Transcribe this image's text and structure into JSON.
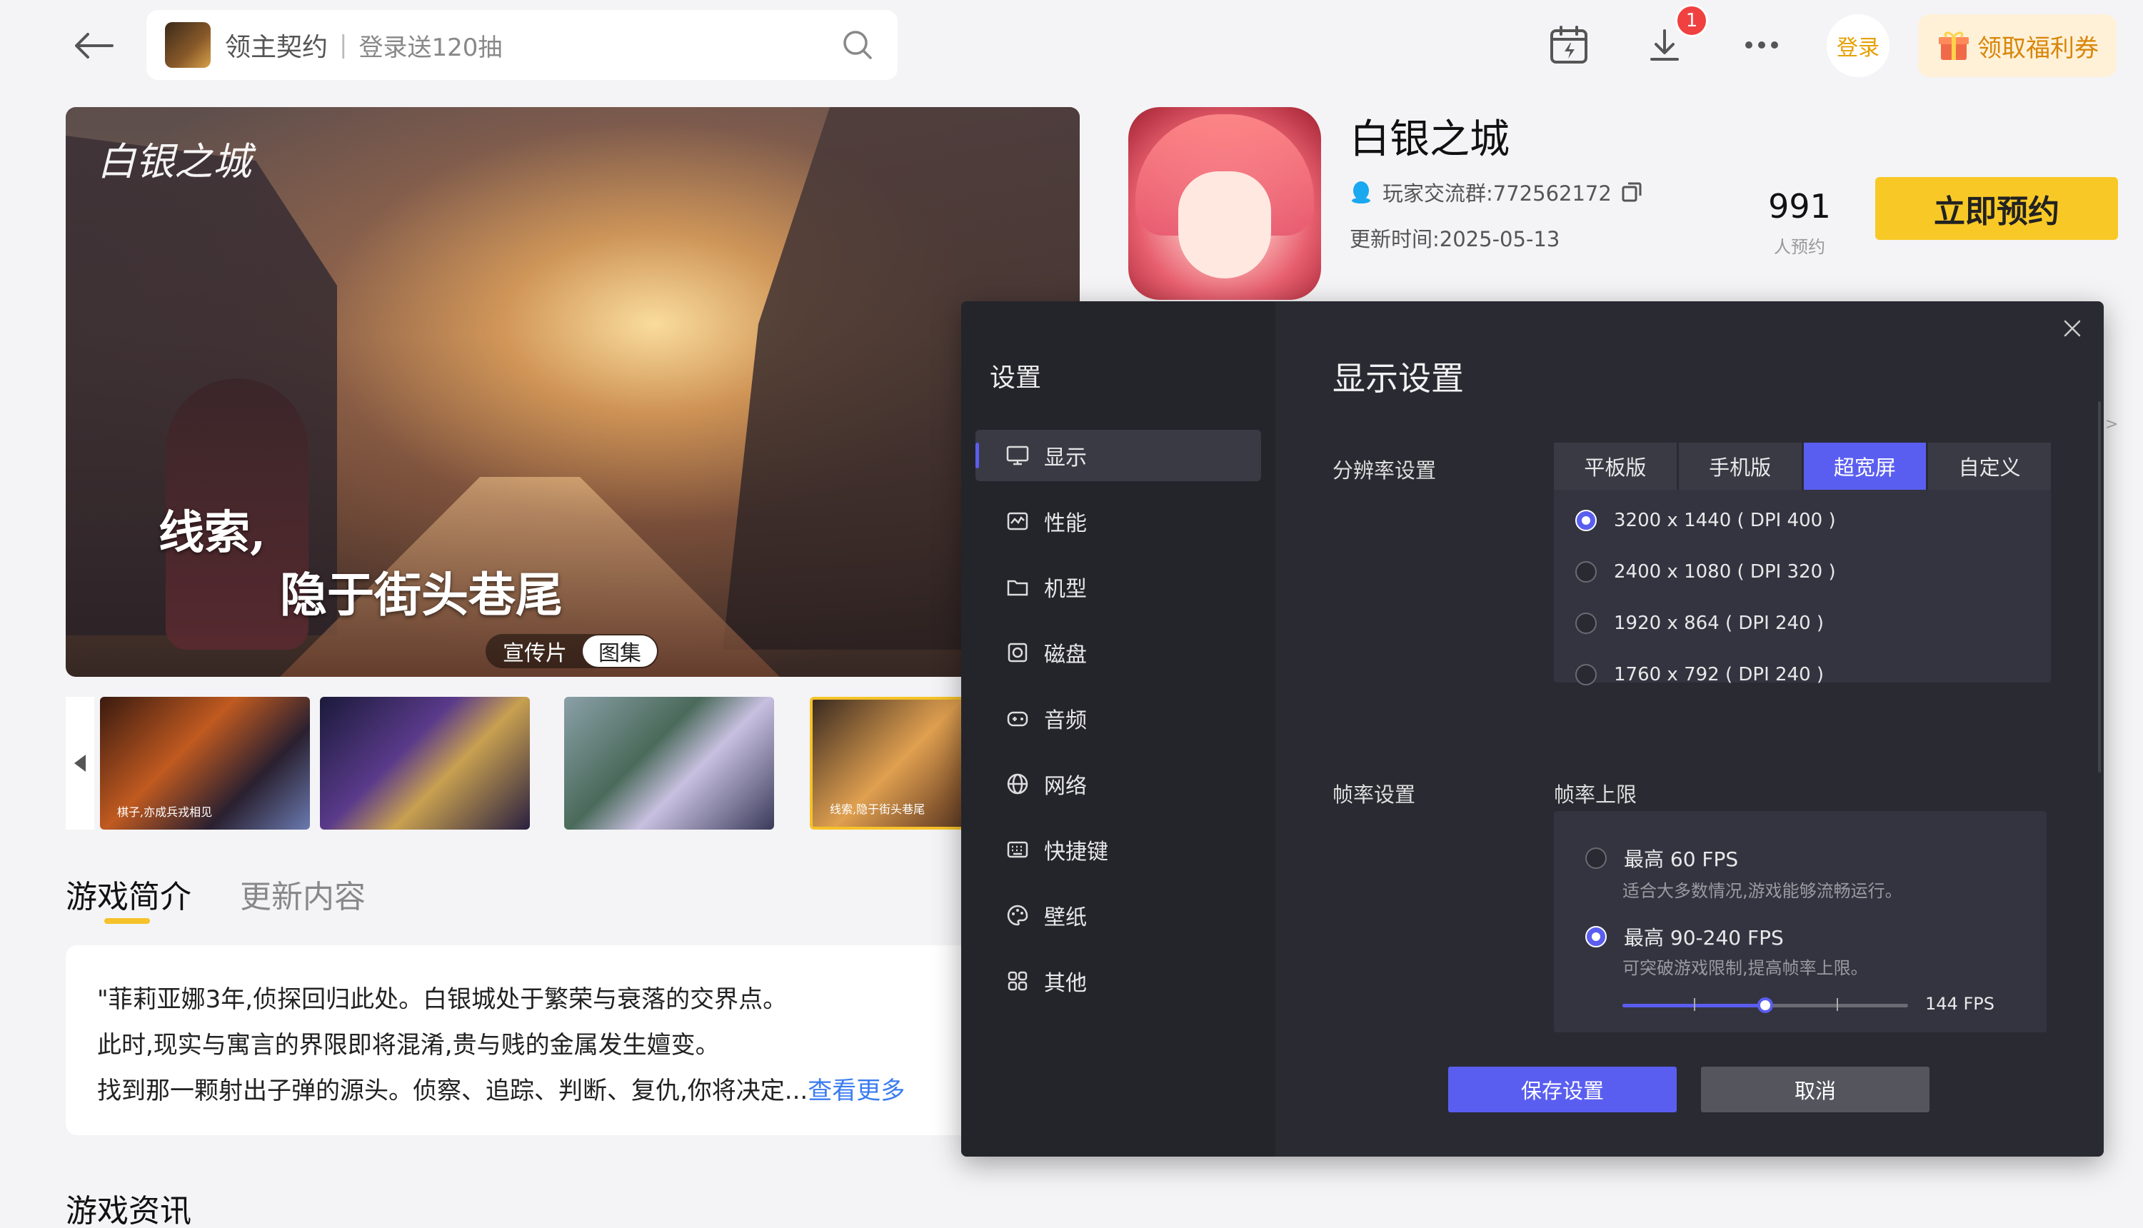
{
  "search": {
    "app_title": "领主契约",
    "separator": "|",
    "promo_text": "登录送120抽"
  },
  "topbar": {
    "download_badge": "1",
    "login_label": "登录",
    "welfare_label": "领取福利券"
  },
  "hero": {
    "logo_text": "白银之城",
    "slogan_line1": "线索,",
    "slogan_line2": "隐于街头巷尾",
    "media_tabs": [
      "宣传片",
      "图集"
    ],
    "active_media_tab": 1
  },
  "thumbnails": [
    {
      "caption": "棋子,亦成兵戎相见",
      "selected": false
    },
    {
      "caption": "",
      "selected": false
    },
    {
      "caption": "",
      "selected": false
    },
    {
      "caption": "线索,隐于街头巷尾",
      "selected": true
    }
  ],
  "intro": {
    "tabs": [
      "游戏简介",
      "更新内容"
    ],
    "active_tab": 0,
    "lines": [
      "\"菲莉亚娜3年,侦探回归此处。白银城处于繁荣与衰落的交界点。",
      "此时,现实与寓言的界限即将混淆,贵与贱的金属发生嬗变。",
      "找到那一颗射出子弹的源头。侦察、追踪、判断、复仇,你将决定..."
    ],
    "more_label": "查看更多",
    "news_title": "游戏资讯"
  },
  "game": {
    "title": "白银之城",
    "group_label": "玩家交流群:772562172",
    "update_label": "更新时间:2025-05-13",
    "reserve_count": "991",
    "reserve_count_label": "人预约",
    "reserve_button": "立即预约"
  },
  "settings": {
    "sidebar_title": "设置",
    "nav": [
      {
        "label": "显示",
        "icon": "monitor-icon",
        "active": true
      },
      {
        "label": "性能",
        "icon": "performance-icon",
        "active": false
      },
      {
        "label": "机型",
        "icon": "device-model-icon",
        "active": false
      },
      {
        "label": "磁盘",
        "icon": "disk-icon",
        "active": false
      },
      {
        "label": "音频",
        "icon": "audio-icon",
        "active": false
      },
      {
        "label": "网络",
        "icon": "network-icon",
        "active": false
      },
      {
        "label": "快捷键",
        "icon": "keyboard-icon",
        "active": false
      },
      {
        "label": "壁纸",
        "icon": "wallpaper-icon",
        "active": false
      },
      {
        "label": "其他",
        "icon": "other-icon",
        "active": false
      }
    ],
    "title": "显示设置",
    "resolution_label": "分辨率设置",
    "resolution_tabs": [
      "平板版",
      "手机版",
      "超宽屏",
      "自定义"
    ],
    "active_resolution_tab": 2,
    "resolutions": [
      {
        "label": "3200 x 1440 ( DPI 400 )",
        "selected": true
      },
      {
        "label": "2400 x 1080 ( DPI 320 )",
        "selected": false
      },
      {
        "label": "1920 x 864 ( DPI 240 )",
        "selected": false
      },
      {
        "label": "1760 x 792 ( DPI 240 )",
        "selected": false
      }
    ],
    "fps_label": "帧率设置",
    "fps_sublabel": "帧率上限",
    "fps_options": [
      {
        "label": "最高 60 FPS",
        "desc": "适合大多数情况,游戏能够流畅运行。",
        "selected": false
      },
      {
        "label": "最高 90-240 FPS",
        "desc": "可突破游戏限制,提高帧率上限。",
        "selected": true
      }
    ],
    "fps_slider_value": "144 FPS",
    "fps_slider_fraction": 0.5,
    "save_button": "保存设置",
    "cancel_button": "取消"
  },
  "colors": {
    "accent": "#5a5ef0",
    "reserve_yellow": "#f8c926",
    "link_blue": "#3a7cf0",
    "badge_red": "#f04040"
  }
}
